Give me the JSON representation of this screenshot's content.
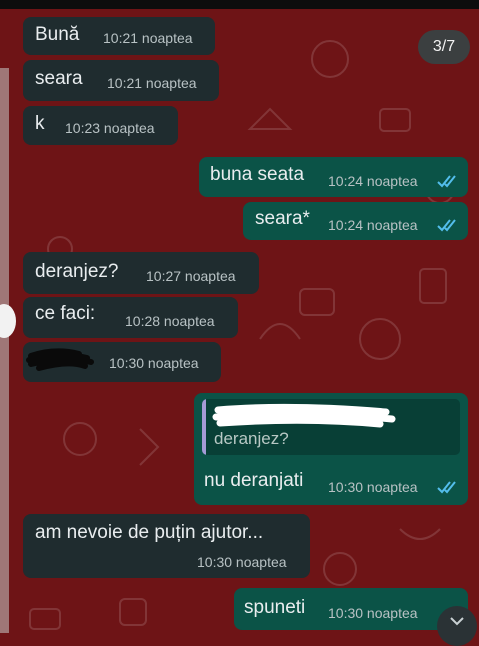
{
  "image_counter": "3/7",
  "messages": [
    {
      "text": "Bună",
      "time": "10:21 noaptea"
    },
    {
      "text": "seara",
      "time": "10:21 noaptea"
    },
    {
      "text": "k",
      "time": "10:23 noaptea"
    },
    {
      "text": "buna seata",
      "time": "10:24 noaptea"
    },
    {
      "text": "seara*",
      "time": "10:24 noaptea"
    },
    {
      "text": "deranjez?",
      "time": "10:27 noaptea"
    },
    {
      "text": "ce faci:",
      "time": "10:28 noaptea"
    },
    {
      "text": "",
      "time": "10:30 noaptea"
    },
    {
      "text": "nu deranjati",
      "time": "10:30 noaptea",
      "quoted_text": "deranjez?"
    },
    {
      "text": "am nevoie de puțin ajutor...",
      "time": "10:30 noaptea"
    },
    {
      "text": "spuneti",
      "time": "10:30 noaptea"
    }
  ],
  "colors": {
    "background": "#6e1416",
    "incoming_bubble": "#1f2c2f",
    "outgoing_bubble": "#0b5347",
    "read_ticks": "#53bdeb",
    "quote_bar": "#a49bd6"
  },
  "icons": [
    "double-check-read-icon",
    "scroll-down-chevron-icon"
  ]
}
